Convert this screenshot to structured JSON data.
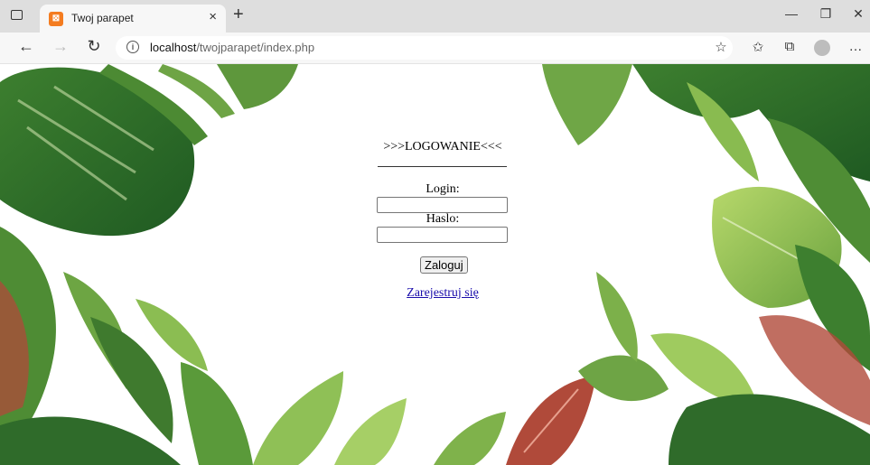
{
  "browser": {
    "tab_title": "Twoj parapet",
    "tab_favicon": "xampp-favicon",
    "new_tab_label": "+",
    "close_tab_label": "×",
    "address_host": "localhost",
    "address_path": "/twojparapet/index.php",
    "icons": [
      "tab-actions-icon",
      "back-icon",
      "forward-icon",
      "refresh-icon",
      "info-icon",
      "favorite-add-icon",
      "favorites-icon",
      "collections-icon",
      "profile-icon",
      "more-icon",
      "minimize-icon",
      "restore-icon",
      "close-window-icon"
    ]
  },
  "page": {
    "heading": ">>>LOGOWANIE<<<",
    "login_label": "Login:",
    "login_value": "",
    "password_label": "Haslo:",
    "password_value": "",
    "submit_label": "Zaloguj",
    "register_link": "Zarejestruj się"
  },
  "colors": {
    "link": "#1a0dab",
    "leaf_dark": "#2f6b2a",
    "leaf_mid": "#5a9a3a",
    "leaf_light": "#9cc65c",
    "leaf_red": "#b04a3a"
  }
}
